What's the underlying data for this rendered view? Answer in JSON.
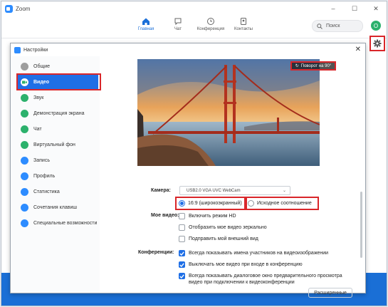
{
  "window": {
    "title": "Zoom",
    "minimize": "–",
    "maximize": "☐",
    "close": "✕"
  },
  "nav": {
    "tabs": [
      {
        "label": "Главная",
        "icon": "home-icon",
        "active": true
      },
      {
        "label": "Чат",
        "icon": "chat-icon"
      },
      {
        "label": "Конференция",
        "icon": "clock-icon"
      },
      {
        "label": "Контакты",
        "icon": "contacts-icon"
      }
    ],
    "search_placeholder": "Поиск",
    "avatar_letter": "О"
  },
  "dialog": {
    "title": "Настройки",
    "close": "✕",
    "sidebar": [
      {
        "label": "Общие",
        "color": "#9e9e9e"
      },
      {
        "label": "Видео",
        "color": "#2cb16c",
        "active": true
      },
      {
        "label": "Звук",
        "color": "#2cb16c"
      },
      {
        "label": "Демонстрация экрана",
        "color": "#2cb16c"
      },
      {
        "label": "Чат",
        "color": "#2cb16c"
      },
      {
        "label": "Виртуальный фон",
        "color": "#2cb16c"
      },
      {
        "label": "Запись",
        "color": "#2d8cff"
      },
      {
        "label": "Профиль",
        "color": "#2d8cff"
      },
      {
        "label": "Статистика",
        "color": "#2d8cff"
      },
      {
        "label": "Сочетания клавиш",
        "color": "#2d8cff"
      },
      {
        "label": "Специальные возможности",
        "color": "#2d8cff"
      }
    ],
    "video": {
      "rotate_label": "Поворот на 90°",
      "camera_label": "Камера:",
      "camera_value": "USB2.0 VGA UVC WebCam",
      "ratio_options": [
        {
          "label": "16:9 (широкоэкранный)",
          "selected": true
        },
        {
          "label": "Исходное соотношение",
          "selected": false
        }
      ],
      "my_video_label": "Мое видео:",
      "my_video_options": [
        {
          "label": "Включить режим HD",
          "checked": false
        },
        {
          "label": "Отобразить мое видео зеркально",
          "checked": false
        },
        {
          "label": "Подправить мой внешний вид",
          "checked": false
        }
      ],
      "conferences_label": "Конференции:",
      "conference_options": [
        {
          "label": "Всегда показывать имена участников на видеоизображении",
          "checked": true
        },
        {
          "label": "Выключать мое видео при входе в конференцию",
          "checked": true
        },
        {
          "label": "Всегда показывать диалоговое окно предварительного просмотра видео при подключении к видеоконференции",
          "checked": true
        }
      ],
      "advanced_button": "Расширенные"
    }
  },
  "colors": {
    "accent": "#1f6fe6",
    "highlight": "#d9262a",
    "taskbar": "#1a6fd6"
  }
}
